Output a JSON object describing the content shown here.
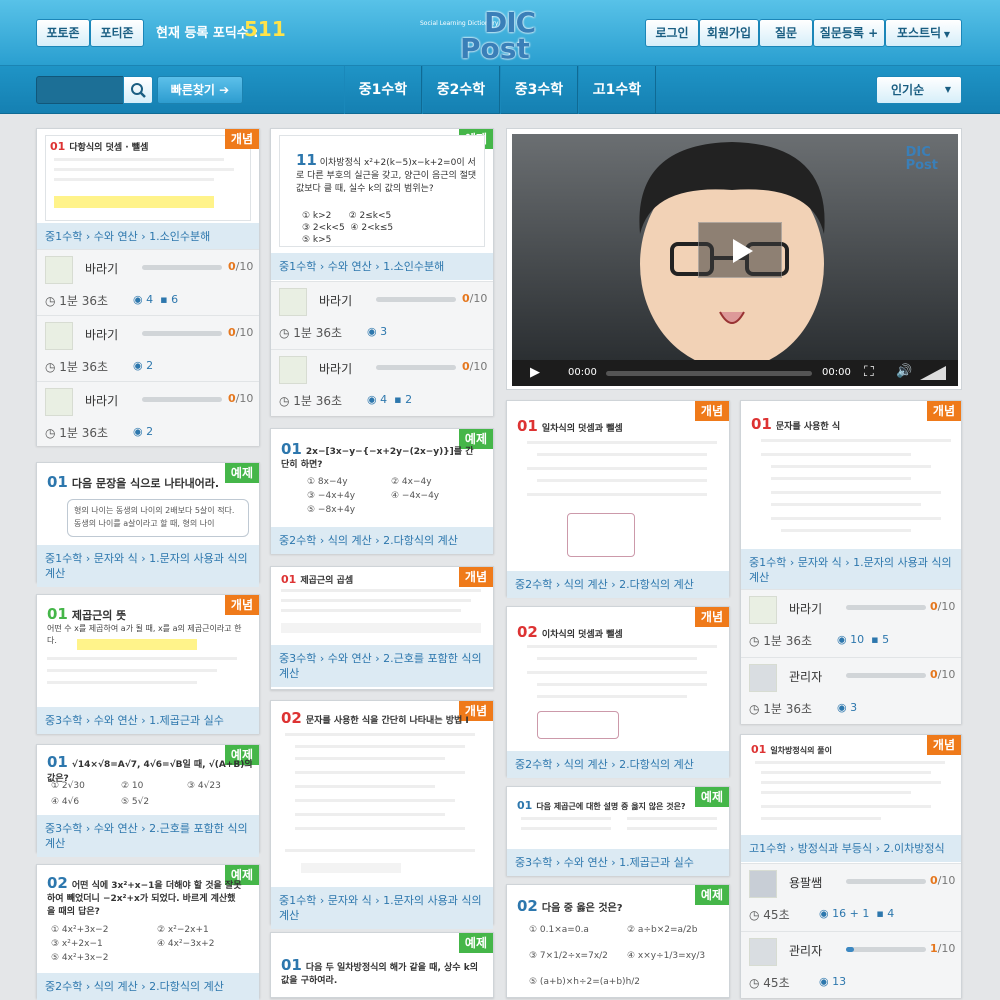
{
  "header": {
    "btn_forum": "포토존",
    "btn_potizone": "포티존",
    "count_label": "현재 등록 포딕수 :",
    "count_value": "511",
    "logo_tag": "Social Learning Dictionary",
    "logo_top": "DIC",
    "logo_bottom": "Post",
    "login": "로그인",
    "signup": "회원가입",
    "question": "질문",
    "question_register": "질문등록",
    "postdic": "포스트딕"
  },
  "subbar": {
    "search_placeholder": "",
    "quick_find": "빠른찾기",
    "grades": [
      "중1수학",
      "중2수학",
      "중3수학",
      "고1수학"
    ],
    "sort": "인기순"
  },
  "video": {
    "time_current": "00:00",
    "time_total": "00:00"
  },
  "cards": {
    "c1": {
      "badge": "개념",
      "path": "중1수학 › 수와 연산 › 1.소인수분해",
      "title_num": "01",
      "title": "다항식의 덧셈 · 뺄셈",
      "rows": [
        {
          "user": "바라기",
          "progress": "0",
          "total": "/10",
          "duration": "1분 36초",
          "views": "4",
          "comments": "6"
        },
        {
          "user": "바라기",
          "progress": "0",
          "total": "/10",
          "duration": "1분 36초",
          "views": "2",
          "comments": ""
        },
        {
          "user": "바라기",
          "progress": "0",
          "total": "/10",
          "duration": "1분 36초",
          "views": "2",
          "comments": ""
        }
      ]
    },
    "c2": {
      "badge": "예제",
      "path": "중1수학 › 수와 연산 › 1.소인수분해",
      "title_num": "11",
      "title": "이차방정식 x²+2(k−5)x−k+2=0이 서로 다른 부호의 실근을 갖고, 양근이 음근의 절댓값보다 클 때, 실수 k의 값의 범위는?",
      "choices": [
        "① k>2",
        "② 2≤k<5",
        "③ 2<k<5",
        "④ 2<k≤5",
        "⑤ k>5"
      ],
      "rows": [
        {
          "user": "바라기",
          "progress": "0",
          "total": "/10",
          "duration": "1분 36초",
          "views": "3",
          "comments": ""
        },
        {
          "user": "바라기",
          "progress": "0",
          "total": "/10",
          "duration": "1분 36초",
          "views": "4",
          "comments": "2"
        }
      ]
    },
    "c3": {
      "badge": "예제",
      "path": "중1수학 › 문자와 식 › 1.문자의 사용과 식의 계산",
      "title_num": "01",
      "title": "다음 문장을 식으로 나타내어라.",
      "body": "형의 나이는 동생의 나이의 2배보다 5살이 적다. 동생의 나이를 a살이라고 할 때, 형의 나이"
    },
    "c4": {
      "badge": "예제",
      "path": "중2수학 › 식의 계산 › 2.다항식의 계산",
      "title_num": "01",
      "title": "2x−[3x−y−{−x+2y−(2x−y)}]를 간단히 하면?",
      "choices": [
        "① 8x−4y",
        "② 4x−4y",
        "③ −4x+4y",
        "④ −4x−4y",
        "⑤ −8x+4y"
      ]
    },
    "c5": {
      "badge": "개념",
      "path": "중3수학 › 수와 연산 › 1.제곱근과 실수",
      "title_num": "01",
      "title": "제곱근의 뜻",
      "body": "어떤 수 x를 제곱하여 a가 될 때, x를 a의 제곱근이라고 한다."
    },
    "c6": {
      "badge": "개념",
      "path": "중3수학 › 수와 연산 › 2.근호를 포함한 식의 계산",
      "title_num": "01",
      "title": "제곱근의 곱셈"
    },
    "c7": {
      "badge": "예제",
      "path": "중3수학 › 수와 연산 › 2.근호를 포함한 식의 계산",
      "title_num": "01",
      "title": "√14×√8=A√7, 4√6=√B일 때, √(A+B)의 값은?",
      "choices": [
        "① 2√30",
        "② 10",
        "③ 4√23",
        "④ 4√6",
        "⑤ 5√2"
      ]
    },
    "c8": {
      "badge": "개념",
      "path": "중1수학 › 문자와 식 › 1.문자의 사용과 식의 계산",
      "title_num": "02",
      "title": "문자를 사용한 식을 간단히 나타내는 방법 Ⅰ"
    },
    "c9": {
      "badge": "예제",
      "path": "중2수학 › 식의 계산 › 2.다항식의 계산",
      "title_num": "02",
      "title": "어떤 식에 3x²+x−1을 더해야 할 것을 잘못하여 빼었더니 −2x²+x가 되었다. 바르게 계산했을 때의 답은?",
      "choices": [
        "① 4x²+3x−2",
        "② x²−2x+1",
        "③ x²+2x−1",
        "④ 4x²−3x+2",
        "⑤ 4x²+3x−2"
      ]
    },
    "c10": {
      "badge": "예제",
      "title_num": "01",
      "title": "다음 두 일차방정식의 해가 같을 때, 상수 k의 값을 구하여라."
    },
    "c11": {
      "badge": "개념",
      "path": "중2수학 › 식의 계산 › 2.다항식의 계산",
      "title_num": "01",
      "title": "일차식의 덧셈과 뺄셈"
    },
    "c12": {
      "badge": "개념",
      "path": "중2수학 › 식의 계산 › 2.다항식의 계산",
      "title_num": "02",
      "title": "이차식의 덧셈과 뺄셈"
    },
    "c13": {
      "badge": "예제",
      "path": "중3수학 › 수와 연산 › 1.제곱근과 실수",
      "title_num": "01",
      "title": "다음 제곱근에 대한 설명 중 옳지 않은 것은?"
    },
    "c14": {
      "badge": "예제",
      "title_num": "02",
      "title": "다음 중 옳은 것은?",
      "choices": [
        "① 0.1×a=0.a",
        "② a÷b×2=a/2b",
        "③ 7×1/2÷x=7x/2",
        "④ x×y÷1/3=xy/3",
        "⑤ (a+b)×h÷2=(a+b)h/2"
      ]
    },
    "c15": {
      "badge": "개념",
      "path": "중1수학 › 문자와 식 › 1.문자의 사용과 식의 계산",
      "title_num": "01",
      "title": "문자를 사용한 식",
      "rows": [
        {
          "user": "바라기",
          "progress": "0",
          "total": "/10",
          "duration": "1분 36초",
          "views": "10",
          "comments": "5"
        },
        {
          "user": "관리자",
          "progress": "0",
          "total": "/10",
          "duration": "1분 36초",
          "views": "3",
          "comments": ""
        }
      ]
    },
    "c16": {
      "badge": "개념",
      "path": "고1수학 › 방정식과 부등식 › 2.이차방정식",
      "title_num": "01",
      "title": "일차방정식의 풀이",
      "rows": [
        {
          "user": "용팔쌤",
          "progress": "0",
          "total": "/10",
          "duration": "45초",
          "views": "16",
          "plus": "1",
          "comments": "4"
        },
        {
          "user": "관리자",
          "progress": "1",
          "total": "/10",
          "duration": "45초",
          "views": "13",
          "comments": ""
        }
      ]
    }
  },
  "colors": {
    "accent": "#2a9fd0",
    "concept_badge": "#ef7a1a",
    "example_badge": "#45b649",
    "count": "#ffe34a"
  }
}
